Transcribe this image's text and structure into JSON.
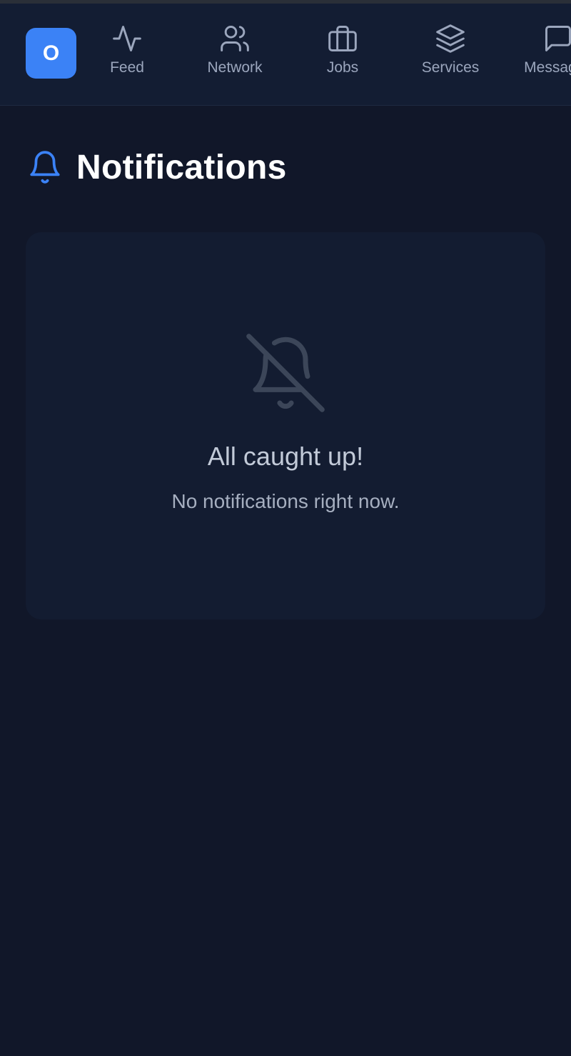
{
  "app": {
    "logo_letter": "O",
    "accent_color": "#3b82f6"
  },
  "nav": {
    "items": [
      {
        "label": "Feed",
        "icon": "activity-icon"
      },
      {
        "label": "Network",
        "icon": "users-icon"
      },
      {
        "label": "Jobs",
        "icon": "briefcase-icon"
      },
      {
        "label": "Services",
        "icon": "layers-icon"
      },
      {
        "label": "Messages",
        "icon": "message-square-icon"
      }
    ]
  },
  "page": {
    "title": "Notifications",
    "icon": "bell-icon"
  },
  "empty_state": {
    "icon": "bell-off-icon",
    "title": "All caught up!",
    "subtitle": "No notifications right now."
  }
}
